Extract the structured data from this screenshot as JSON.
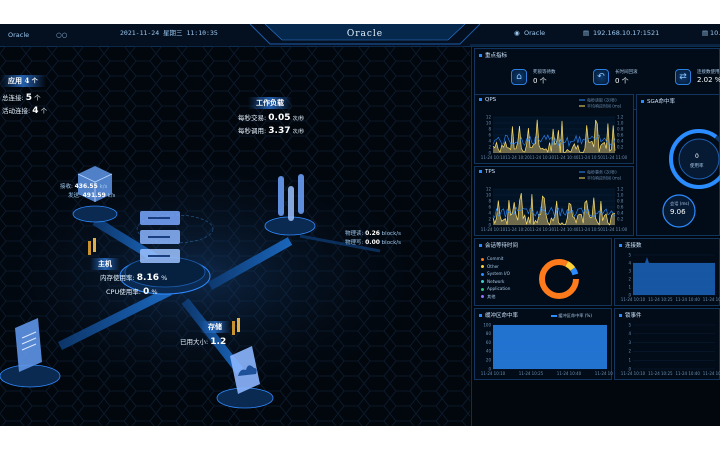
{
  "topbar": {
    "left_label": "Oracle",
    "left_mark": "○○",
    "datetime": "2021-11-24 星期三  11:10:35",
    "title": "Oracle",
    "right_name": "Oracle",
    "ip1": "192.168.10.17:1521",
    "ip2": "10.2.1."
  },
  "left": {
    "app": {
      "label": "应用",
      "count": "4",
      "unit": "个"
    },
    "total_conn": {
      "label": "总连接:",
      "value": "5",
      "unit": "个"
    },
    "active_conn": {
      "label": "活动连接:",
      "value": "4",
      "unit": "个"
    },
    "workload": {
      "title": "工作负载",
      "tx_label": "每秒交易:",
      "tx_value": "0.05",
      "tx_unit": "次/秒",
      "call_label": "每秒调用:",
      "call_value": "3.37",
      "call_unit": "次/秒"
    },
    "net": {
      "recv_label": "接收:",
      "recv_value": "436.55",
      "recv_unit": "k/s",
      "send_label": "发送:",
      "send_value": "491.59",
      "send_unit": "k/s"
    },
    "io": {
      "read_label": "物理读:",
      "read_value": "0.26",
      "read_unit": "block/s",
      "write_label": "物理写:",
      "write_value": "0.00",
      "write_unit": "block/s"
    },
    "host": {
      "title": "主机",
      "mem_label": "内存使用率:",
      "mem_value": "8.16",
      "mem_unit": "%",
      "cpu_label": "CPU使用率:",
      "cpu_value": "0",
      "cpu_unit": "%"
    },
    "storage": {
      "title": "存储",
      "used_label": "已用大小:",
      "used_value": "1.2"
    }
  },
  "kpi": {
    "title": "重点指标",
    "items": [
      {
        "icon": "lock-icon",
        "glyph": "⌂",
        "label": "死锁等待数",
        "value": "0",
        "unit": "个"
      },
      {
        "icon": "rollback-icon",
        "glyph": "↶",
        "label": "长时间回滚",
        "value": "0",
        "unit": "个"
      },
      {
        "icon": "connection-rate-icon",
        "glyph": "⇄",
        "label": "连接数使用率",
        "value": "2.02",
        "unit": "%"
      }
    ]
  },
  "qps": {
    "title": "QPS",
    "legend": [
      "每秒读取 (次/秒)",
      "平均响应时间 (ms)"
    ],
    "yleft": [
      "0",
      "2",
      "4",
      "6",
      "8",
      "10",
      "12"
    ],
    "yright": [
      "0.2",
      "0.4",
      "0.6",
      "0.8",
      "1.0",
      "1.2"
    ],
    "xlabels": [
      "11-24 10:10",
      "11-24 10:20",
      "11-24 10:30",
      "11-24 10:40",
      "11-24 10:50",
      "11-24 11:00"
    ]
  },
  "tps": {
    "title": "TPS",
    "legend": [
      "每秒事务 (次/秒)",
      "平均响应时间 (ms)"
    ],
    "yleft": [
      "0",
      "2",
      "4",
      "6",
      "8",
      "10",
      "12"
    ],
    "yright": [
      "0.2",
      "0.4",
      "0.6",
      "0.8",
      "1.0",
      "1.2"
    ],
    "xlabels": [
      "11-24 10:10",
      "11-24 10:20",
      "11-24 10:30",
      "11-24 10:40",
      "11-24 10:50",
      "11-24 11:00"
    ]
  },
  "sga": {
    "title": "SGA命中率",
    "center_label": "使用率",
    "session_label": "会话 (ms)",
    "session_value": "9.06"
  },
  "waits": {
    "title": "会话等待时间",
    "legend": [
      "Commit",
      "Other",
      "System I/O",
      "Network",
      "Application",
      "其他"
    ],
    "colors": [
      "#ff7a1a",
      "#ffd23a",
      "#2b8cff",
      "#3fd0d0",
      "#2fc27f",
      "#9a6cff"
    ]
  },
  "conn": {
    "title": "连接数",
    "y": [
      "0",
      "1",
      "2",
      "3",
      "4",
      "5"
    ],
    "x": [
      "11-24 10:10",
      "11-24 10:25",
      "11-24 10:40",
      "11-24 10:55"
    ]
  },
  "buffer": {
    "title": "缓冲区命中率",
    "legend": "缓冲区命中率 (%)",
    "y": [
      "0",
      "20",
      "40",
      "60",
      "80",
      "100"
    ],
    "x": [
      "11-24 10:10",
      "11-24 10:25",
      "11-24 10:40",
      "11-24 10:55"
    ]
  },
  "locks": {
    "title": "锁事件",
    "y": [
      "0",
      "1",
      "2",
      "3",
      "4",
      "5"
    ],
    "x": [
      "11-24 10:10",
      "11-24 10:25",
      "11-24 10:40",
      "11-24 10:55"
    ]
  }
}
